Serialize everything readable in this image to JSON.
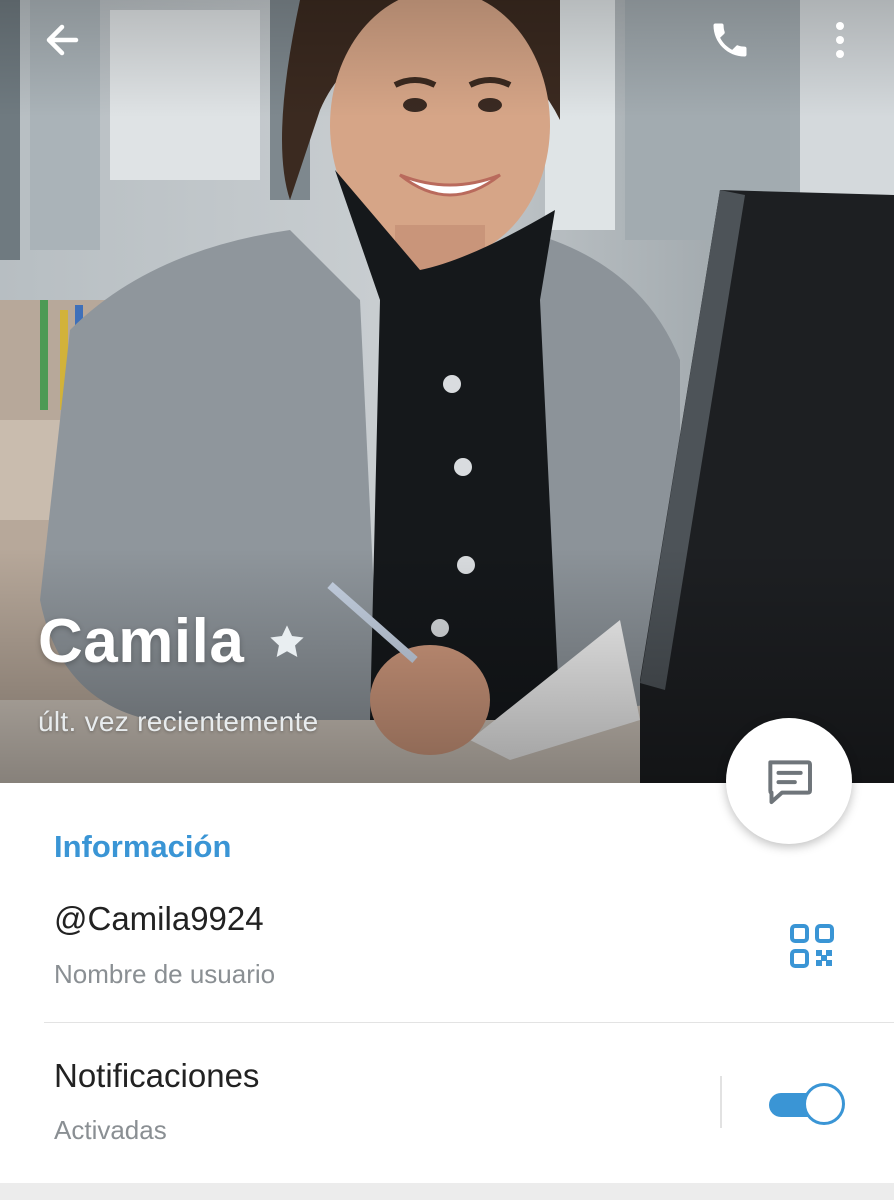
{
  "header": {
    "name": "Camila",
    "status": "últ. vez recientemente",
    "icons": {
      "back": "arrow-left-icon",
      "call": "phone-icon",
      "more": "more-vertical-icon",
      "favorite": "star-icon"
    }
  },
  "fab": {
    "icon": "message-icon"
  },
  "info": {
    "section_title": "Información",
    "username_value": "@Camila9924",
    "username_label": "Nombre de usuario",
    "qr_icon": "qr-code-icon",
    "notifications_label": "Notificaciones",
    "notifications_value": "Activadas",
    "notifications_enabled": true
  },
  "colors": {
    "accent": "#3a95d5",
    "primary_text": "#222222",
    "secondary_text": "#8a8f93"
  }
}
